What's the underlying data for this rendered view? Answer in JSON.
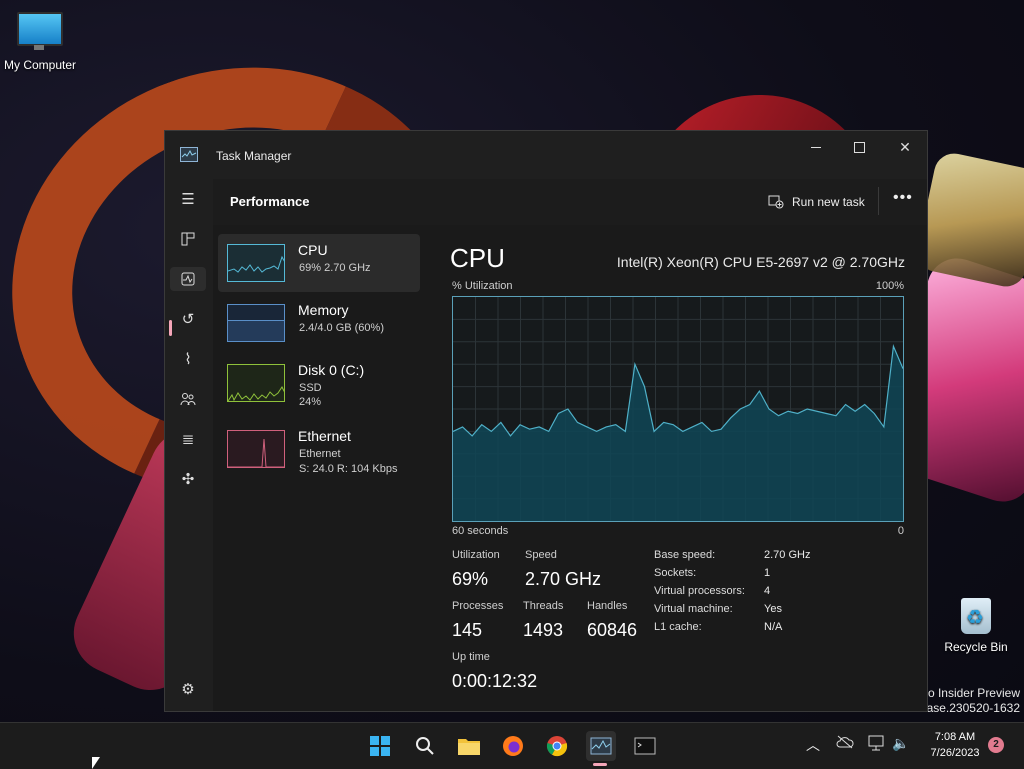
{
  "desktop": {
    "my_computer_label": "My Computer",
    "recycle_bin_label": "Recycle Bin",
    "watermark_line1": "ro Insider Preview",
    "watermark_line2": "ease.230520-1632"
  },
  "window": {
    "title": "Task Manager",
    "page_title": "Performance",
    "run_new_task": "Run new task",
    "more": "•••"
  },
  "devices": [
    {
      "name": "CPU",
      "line1": "69% 2.70 GHz",
      "line2": "",
      "color": "#55b9d6"
    },
    {
      "name": "Memory",
      "line1": "2.4/4.0 GB (60%)",
      "line2": "",
      "color": "#5a8fc8"
    },
    {
      "name": "Disk 0 (C:)",
      "line1": "SSD",
      "line2": "24%",
      "color": "#8fc13a"
    },
    {
      "name": "Ethernet",
      "line1": "Ethernet",
      "line2": "S: 24.0  R: 104 Kbps",
      "color": "#d0607c"
    }
  ],
  "cpu": {
    "heading": "CPU",
    "model": "Intel(R) Xeon(R) CPU E5-2697 v2 @ 2.70GHz",
    "util_label": "% Utilization",
    "max_label": "100%",
    "time_label": "60 seconds",
    "zero_label": "0",
    "stats": {
      "utilization_label": "Utilization",
      "utilization": "69%",
      "speed_label": "Speed",
      "speed": "2.70 GHz",
      "processes_label": "Processes",
      "processes": "145",
      "threads_label": "Threads",
      "threads": "1493",
      "handles_label": "Handles",
      "handles": "60846",
      "uptime_label": "Up time",
      "uptime": "0:00:12:32"
    },
    "specs": [
      {
        "k": "Base speed:",
        "v": "2.70 GHz"
      },
      {
        "k": "Sockets:",
        "v": "1"
      },
      {
        "k": "Virtual processors:",
        "v": "4"
      },
      {
        "k": "Virtual machine:",
        "v": "Yes"
      },
      {
        "k": "L1 cache:",
        "v": "N/A"
      }
    ]
  },
  "chart_data": {
    "type": "area",
    "ylim": [
      0,
      100
    ],
    "xlim": [
      60,
      0
    ],
    "xlabel": "60 seconds",
    "ylabel": "% Utilization",
    "series": [
      {
        "values": [
          40,
          42,
          38,
          43,
          40,
          44,
          38,
          43,
          41,
          42,
          40,
          48,
          50,
          44,
          42,
          40,
          42,
          43,
          40,
          70,
          60,
          40,
          44,
          43,
          40,
          42,
          44,
          40,
          41,
          46,
          50,
          52,
          58,
          50,
          47,
          49,
          48,
          50,
          49,
          48,
          47,
          52,
          49,
          52,
          48,
          42,
          78,
          68
        ]
      }
    ],
    "colors": {
      "line": "#4fb0c8",
      "fill": "#0f4656"
    }
  },
  "taskbar": {
    "time": "7:08 AM",
    "date": "7/26/2023",
    "notifications": "2"
  }
}
